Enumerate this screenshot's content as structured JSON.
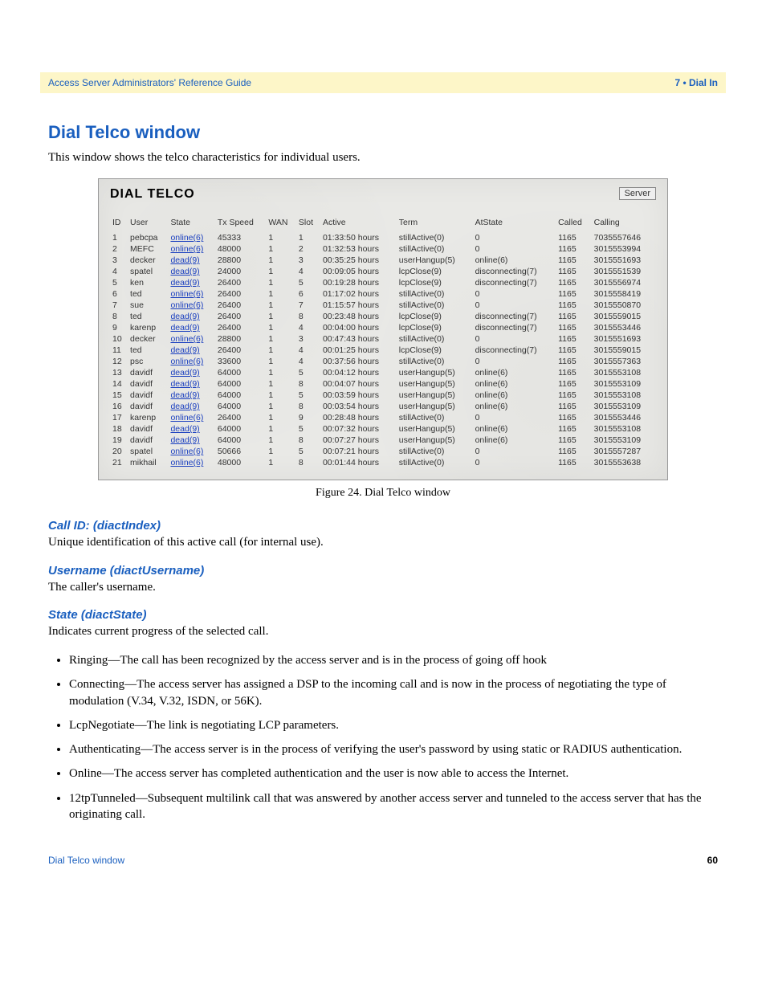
{
  "header": {
    "left": "Access Server Administrators' Reference Guide",
    "right": "7 • Dial In"
  },
  "h1": "Dial Telco window",
  "intro": "This window shows the telco characteristics for individual users.",
  "fig": {
    "title": "DIAL TELCO",
    "button": "Server",
    "cols": [
      "ID",
      "User",
      "State",
      "Tx Speed",
      "WAN",
      "Slot",
      "Active",
      "Term",
      "AtState",
      "Called",
      "Calling"
    ],
    "rows": [
      {
        "id": "1",
        "user": "pebcpa",
        "state": "online(6)",
        "tx": "45333",
        "wan": "1",
        "slot": "1",
        "active": "01:33:50 hours",
        "term": "stillActive(0)",
        "at": "0",
        "called": "1165",
        "calling": "7035557646"
      },
      {
        "id": "2",
        "user": "MEFC",
        "state": "online(6)",
        "tx": "48000",
        "wan": "1",
        "slot": "2",
        "active": "01:32:53 hours",
        "term": "stillActive(0)",
        "at": "0",
        "called": "1165",
        "calling": "3015553994"
      },
      {
        "id": "3",
        "user": "decker",
        "state": "dead(9)",
        "tx": "28800",
        "wan": "1",
        "slot": "3",
        "active": "00:35:25 hours",
        "term": "userHangup(5)",
        "at": "online(6)",
        "called": "1165",
        "calling": "3015551693"
      },
      {
        "id": "4",
        "user": "spatel",
        "state": "dead(9)",
        "tx": "24000",
        "wan": "1",
        "slot": "4",
        "active": "00:09:05 hours",
        "term": "lcpClose(9)",
        "at": "disconnecting(7)",
        "called": "1165",
        "calling": "3015551539"
      },
      {
        "id": "5",
        "user": "ken",
        "state": "dead(9)",
        "tx": "26400",
        "wan": "1",
        "slot": "5",
        "active": "00:19:28 hours",
        "term": "lcpClose(9)",
        "at": "disconnecting(7)",
        "called": "1165",
        "calling": "3015556974"
      },
      {
        "id": "6",
        "user": "ted",
        "state": "online(6)",
        "tx": "26400",
        "wan": "1",
        "slot": "6",
        "active": "01:17:02 hours",
        "term": "stillActive(0)",
        "at": "0",
        "called": "1165",
        "calling": "3015558419"
      },
      {
        "id": "7",
        "user": "sue",
        "state": "online(6)",
        "tx": "26400",
        "wan": "1",
        "slot": "7",
        "active": "01:15:57 hours",
        "term": "stillActive(0)",
        "at": "0",
        "called": "1165",
        "calling": "3015550870"
      },
      {
        "id": "8",
        "user": "ted",
        "state": "dead(9)",
        "tx": "26400",
        "wan": "1",
        "slot": "8",
        "active": "00:23:48 hours",
        "term": "lcpClose(9)",
        "at": "disconnecting(7)",
        "called": "1165",
        "calling": "3015559015"
      },
      {
        "id": "9",
        "user": "karenp",
        "state": "dead(9)",
        "tx": "26400",
        "wan": "1",
        "slot": "4",
        "active": "00:04:00 hours",
        "term": "lcpClose(9)",
        "at": "disconnecting(7)",
        "called": "1165",
        "calling": "3015553446"
      },
      {
        "id": "10",
        "user": "decker",
        "state": "online(6)",
        "tx": "28800",
        "wan": "1",
        "slot": "3",
        "active": "00:47:43 hours",
        "term": "stillActive(0)",
        "at": "0",
        "called": "1165",
        "calling": "3015551693"
      },
      {
        "id": "11",
        "user": "ted",
        "state": "dead(9)",
        "tx": "26400",
        "wan": "1",
        "slot": "4",
        "active": "00:01:25 hours",
        "term": "lcpClose(9)",
        "at": "disconnecting(7)",
        "called": "1165",
        "calling": "3015559015"
      },
      {
        "id": "12",
        "user": "psc",
        "state": "online(6)",
        "tx": "33600",
        "wan": "1",
        "slot": "4",
        "active": "00:37:56 hours",
        "term": "stillActive(0)",
        "at": "0",
        "called": "1165",
        "calling": "3015557363"
      },
      {
        "id": "13",
        "user": "davidf",
        "state": "dead(9)",
        "tx": "64000",
        "wan": "1",
        "slot": "5",
        "active": "00:04:12 hours",
        "term": "userHangup(5)",
        "at": "online(6)",
        "called": "1165",
        "calling": "3015553108"
      },
      {
        "id": "14",
        "user": "davidf",
        "state": "dead(9)",
        "tx": "64000",
        "wan": "1",
        "slot": "8",
        "active": "00:04:07 hours",
        "term": "userHangup(5)",
        "at": "online(6)",
        "called": "1165",
        "calling": "3015553109"
      },
      {
        "id": "15",
        "user": "davidf",
        "state": "dead(9)",
        "tx": "64000",
        "wan": "1",
        "slot": "5",
        "active": "00:03:59 hours",
        "term": "userHangup(5)",
        "at": "online(6)",
        "called": "1165",
        "calling": "3015553108"
      },
      {
        "id": "16",
        "user": "davidf",
        "state": "dead(9)",
        "tx": "64000",
        "wan": "1",
        "slot": "8",
        "active": "00:03:54 hours",
        "term": "userHangup(5)",
        "at": "online(6)",
        "called": "1165",
        "calling": "3015553109"
      },
      {
        "id": "17",
        "user": "karenp",
        "state": "online(6)",
        "tx": "26400",
        "wan": "1",
        "slot": "9",
        "active": "00:28:48 hours",
        "term": "stillActive(0)",
        "at": "0",
        "called": "1165",
        "calling": "3015553446"
      },
      {
        "id": "18",
        "user": "davidf",
        "state": "dead(9)",
        "tx": "64000",
        "wan": "1",
        "slot": "5",
        "active": "00:07:32 hours",
        "term": "userHangup(5)",
        "at": "online(6)",
        "called": "1165",
        "calling": "3015553108"
      },
      {
        "id": "19",
        "user": "davidf",
        "state": "dead(9)",
        "tx": "64000",
        "wan": "1",
        "slot": "8",
        "active": "00:07:27 hours",
        "term": "userHangup(5)",
        "at": "online(6)",
        "called": "1165",
        "calling": "3015553109"
      },
      {
        "id": "20",
        "user": "spatel",
        "state": "online(6)",
        "tx": "50666",
        "wan": "1",
        "slot": "5",
        "active": "00:07:21 hours",
        "term": "stillActive(0)",
        "at": "0",
        "called": "1165",
        "calling": "3015557287"
      },
      {
        "id": "21",
        "user": "mikhail",
        "state": "online(6)",
        "tx": "48000",
        "wan": "1",
        "slot": "8",
        "active": "00:01:44 hours",
        "term": "stillActive(0)",
        "at": "0",
        "called": "1165",
        "calling": "3015553638"
      }
    ]
  },
  "caption": "Figure 24. Dial Telco window",
  "sections": [
    {
      "h": "Call ID: (diactIndex)",
      "p": "Unique identification of this active call (for internal use)."
    },
    {
      "h": "Username (diactUsername)",
      "p": "The caller's username."
    },
    {
      "h": "State (diactState)",
      "p": "Indicates current progress of the selected call."
    }
  ],
  "bullets": [
    "Ringing—The call has been recognized by the access server and is in the process of going off hook",
    "Connecting—The access server has assigned a DSP to the incoming call and is now in the process of negotiating the type of modulation (V.34, V.32, ISDN, or 56K).",
    "LcpNegotiate—The link is negotiating LCP parameters.",
    "Authenticating—The access server is in the process of verifying the user's password by using static or RADIUS authentication.",
    "Online—The access server has completed authentication and the user is now able to access the Internet.",
    "12tpTunneled—Subsequent multilink call that was answered by another access server and tunneled to the access server that has the originating call."
  ],
  "footer": {
    "left": "Dial Telco window",
    "right": "60"
  }
}
